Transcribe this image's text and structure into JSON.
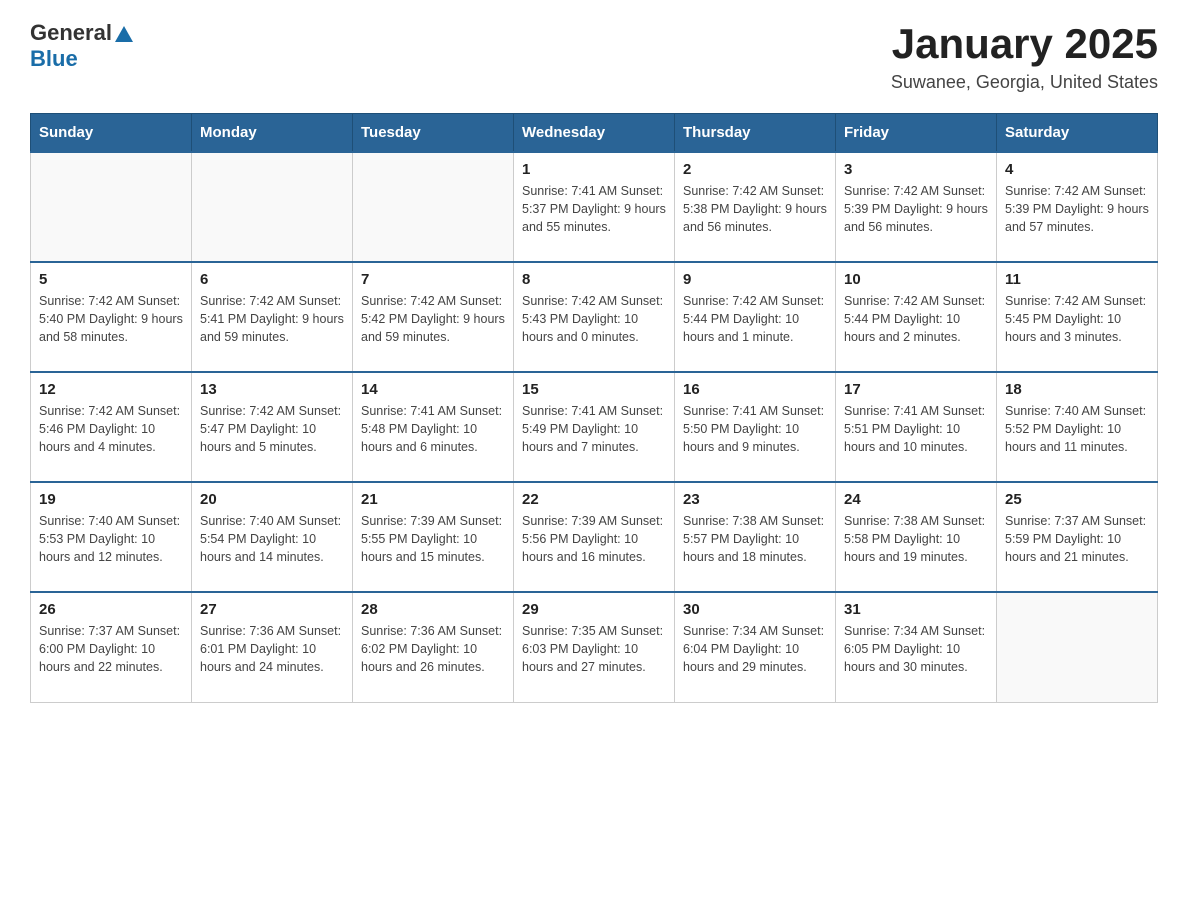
{
  "header": {
    "logo_general": "General",
    "logo_blue": "Blue",
    "month": "January 2025",
    "location": "Suwanee, Georgia, United States"
  },
  "weekdays": [
    "Sunday",
    "Monday",
    "Tuesday",
    "Wednesday",
    "Thursday",
    "Friday",
    "Saturday"
  ],
  "weeks": [
    [
      {
        "day": "",
        "info": ""
      },
      {
        "day": "",
        "info": ""
      },
      {
        "day": "",
        "info": ""
      },
      {
        "day": "1",
        "info": "Sunrise: 7:41 AM\nSunset: 5:37 PM\nDaylight: 9 hours\nand 55 minutes."
      },
      {
        "day": "2",
        "info": "Sunrise: 7:42 AM\nSunset: 5:38 PM\nDaylight: 9 hours\nand 56 minutes."
      },
      {
        "day": "3",
        "info": "Sunrise: 7:42 AM\nSunset: 5:39 PM\nDaylight: 9 hours\nand 56 minutes."
      },
      {
        "day": "4",
        "info": "Sunrise: 7:42 AM\nSunset: 5:39 PM\nDaylight: 9 hours\nand 57 minutes."
      }
    ],
    [
      {
        "day": "5",
        "info": "Sunrise: 7:42 AM\nSunset: 5:40 PM\nDaylight: 9 hours\nand 58 minutes."
      },
      {
        "day": "6",
        "info": "Sunrise: 7:42 AM\nSunset: 5:41 PM\nDaylight: 9 hours\nand 59 minutes."
      },
      {
        "day": "7",
        "info": "Sunrise: 7:42 AM\nSunset: 5:42 PM\nDaylight: 9 hours\nand 59 minutes."
      },
      {
        "day": "8",
        "info": "Sunrise: 7:42 AM\nSunset: 5:43 PM\nDaylight: 10 hours\nand 0 minutes."
      },
      {
        "day": "9",
        "info": "Sunrise: 7:42 AM\nSunset: 5:44 PM\nDaylight: 10 hours\nand 1 minute."
      },
      {
        "day": "10",
        "info": "Sunrise: 7:42 AM\nSunset: 5:44 PM\nDaylight: 10 hours\nand 2 minutes."
      },
      {
        "day": "11",
        "info": "Sunrise: 7:42 AM\nSunset: 5:45 PM\nDaylight: 10 hours\nand 3 minutes."
      }
    ],
    [
      {
        "day": "12",
        "info": "Sunrise: 7:42 AM\nSunset: 5:46 PM\nDaylight: 10 hours\nand 4 minutes."
      },
      {
        "day": "13",
        "info": "Sunrise: 7:42 AM\nSunset: 5:47 PM\nDaylight: 10 hours\nand 5 minutes."
      },
      {
        "day": "14",
        "info": "Sunrise: 7:41 AM\nSunset: 5:48 PM\nDaylight: 10 hours\nand 6 minutes."
      },
      {
        "day": "15",
        "info": "Sunrise: 7:41 AM\nSunset: 5:49 PM\nDaylight: 10 hours\nand 7 minutes."
      },
      {
        "day": "16",
        "info": "Sunrise: 7:41 AM\nSunset: 5:50 PM\nDaylight: 10 hours\nand 9 minutes."
      },
      {
        "day": "17",
        "info": "Sunrise: 7:41 AM\nSunset: 5:51 PM\nDaylight: 10 hours\nand 10 minutes."
      },
      {
        "day": "18",
        "info": "Sunrise: 7:40 AM\nSunset: 5:52 PM\nDaylight: 10 hours\nand 11 minutes."
      }
    ],
    [
      {
        "day": "19",
        "info": "Sunrise: 7:40 AM\nSunset: 5:53 PM\nDaylight: 10 hours\nand 12 minutes."
      },
      {
        "day": "20",
        "info": "Sunrise: 7:40 AM\nSunset: 5:54 PM\nDaylight: 10 hours\nand 14 minutes."
      },
      {
        "day": "21",
        "info": "Sunrise: 7:39 AM\nSunset: 5:55 PM\nDaylight: 10 hours\nand 15 minutes."
      },
      {
        "day": "22",
        "info": "Sunrise: 7:39 AM\nSunset: 5:56 PM\nDaylight: 10 hours\nand 16 minutes."
      },
      {
        "day": "23",
        "info": "Sunrise: 7:38 AM\nSunset: 5:57 PM\nDaylight: 10 hours\nand 18 minutes."
      },
      {
        "day": "24",
        "info": "Sunrise: 7:38 AM\nSunset: 5:58 PM\nDaylight: 10 hours\nand 19 minutes."
      },
      {
        "day": "25",
        "info": "Sunrise: 7:37 AM\nSunset: 5:59 PM\nDaylight: 10 hours\nand 21 minutes."
      }
    ],
    [
      {
        "day": "26",
        "info": "Sunrise: 7:37 AM\nSunset: 6:00 PM\nDaylight: 10 hours\nand 22 minutes."
      },
      {
        "day": "27",
        "info": "Sunrise: 7:36 AM\nSunset: 6:01 PM\nDaylight: 10 hours\nand 24 minutes."
      },
      {
        "day": "28",
        "info": "Sunrise: 7:36 AM\nSunset: 6:02 PM\nDaylight: 10 hours\nand 26 minutes."
      },
      {
        "day": "29",
        "info": "Sunrise: 7:35 AM\nSunset: 6:03 PM\nDaylight: 10 hours\nand 27 minutes."
      },
      {
        "day": "30",
        "info": "Sunrise: 7:34 AM\nSunset: 6:04 PM\nDaylight: 10 hours\nand 29 minutes."
      },
      {
        "day": "31",
        "info": "Sunrise: 7:34 AM\nSunset: 6:05 PM\nDaylight: 10 hours\nand 30 minutes."
      },
      {
        "day": "",
        "info": ""
      }
    ]
  ]
}
